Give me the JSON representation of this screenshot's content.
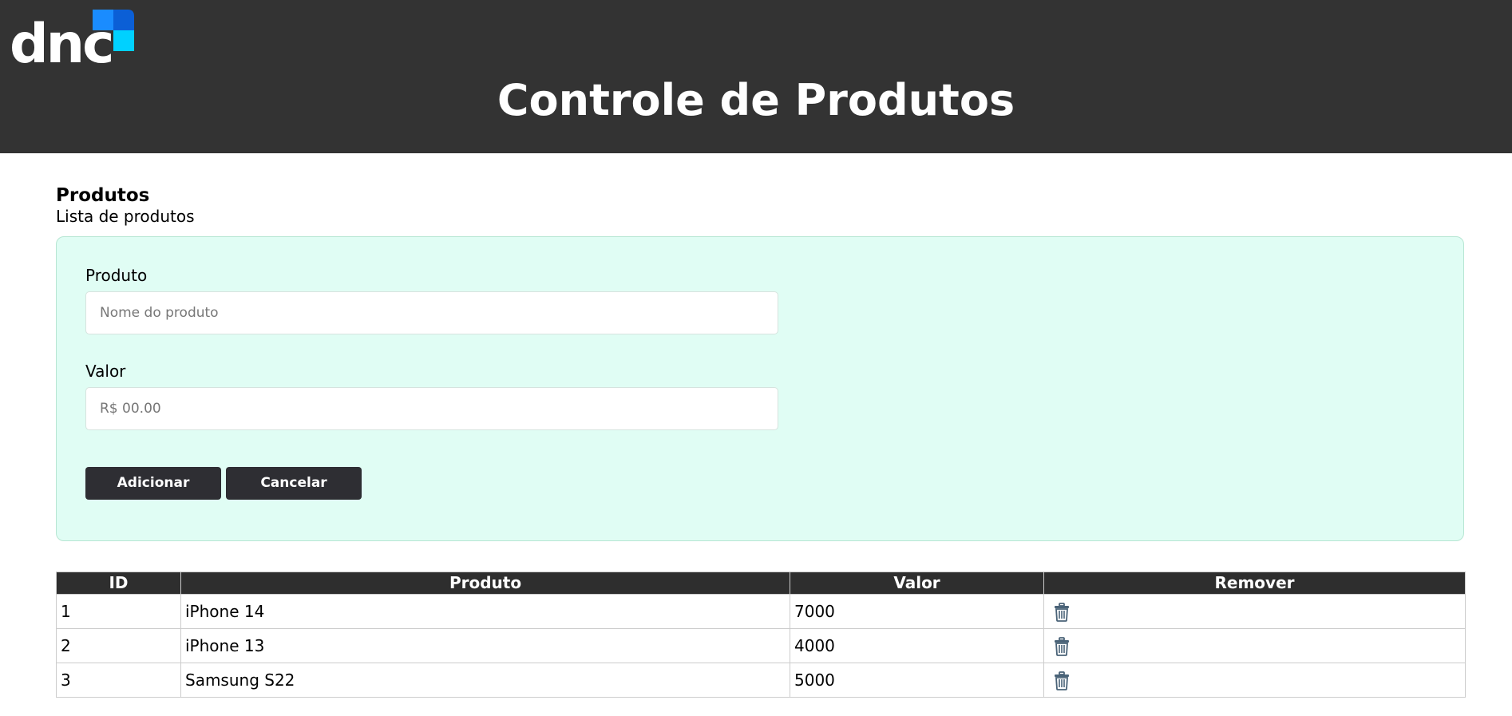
{
  "header": {
    "logo_text": "dnc",
    "title": "Controle de Produtos"
  },
  "section": {
    "title": "Produtos",
    "subtitle": "Lista de produtos"
  },
  "form": {
    "product_label": "Produto",
    "product_placeholder": "Nome do produto",
    "product_value": "",
    "price_label": "Valor",
    "price_placeholder": "R$ 00.00",
    "price_value": "",
    "add_label": "Adicionar",
    "cancel_label": "Cancelar"
  },
  "table": {
    "columns": [
      "ID",
      "Produto",
      "Valor",
      "Remover"
    ],
    "rows": [
      {
        "id": "1",
        "produto": "iPhone 14",
        "valor": "7000",
        "remove_icon": "trash-icon"
      },
      {
        "id": "2",
        "produto": "iPhone 13",
        "valor": "4000",
        "remove_icon": "trash-icon"
      },
      {
        "id": "3",
        "produto": "Samsung S22",
        "valor": "5000",
        "remove_icon": "trash-icon"
      }
    ]
  },
  "colors": {
    "header_bg": "#333333",
    "panel_bg": "#e0fdf4",
    "button_bg": "#2e2e33",
    "table_header_bg": "#2e2e2e",
    "logo_blue": "#1a8cff",
    "logo_cyan": "#00d1ff",
    "logo_dark_blue": "#0b5fd6",
    "trash_icon": "#4a6378"
  }
}
